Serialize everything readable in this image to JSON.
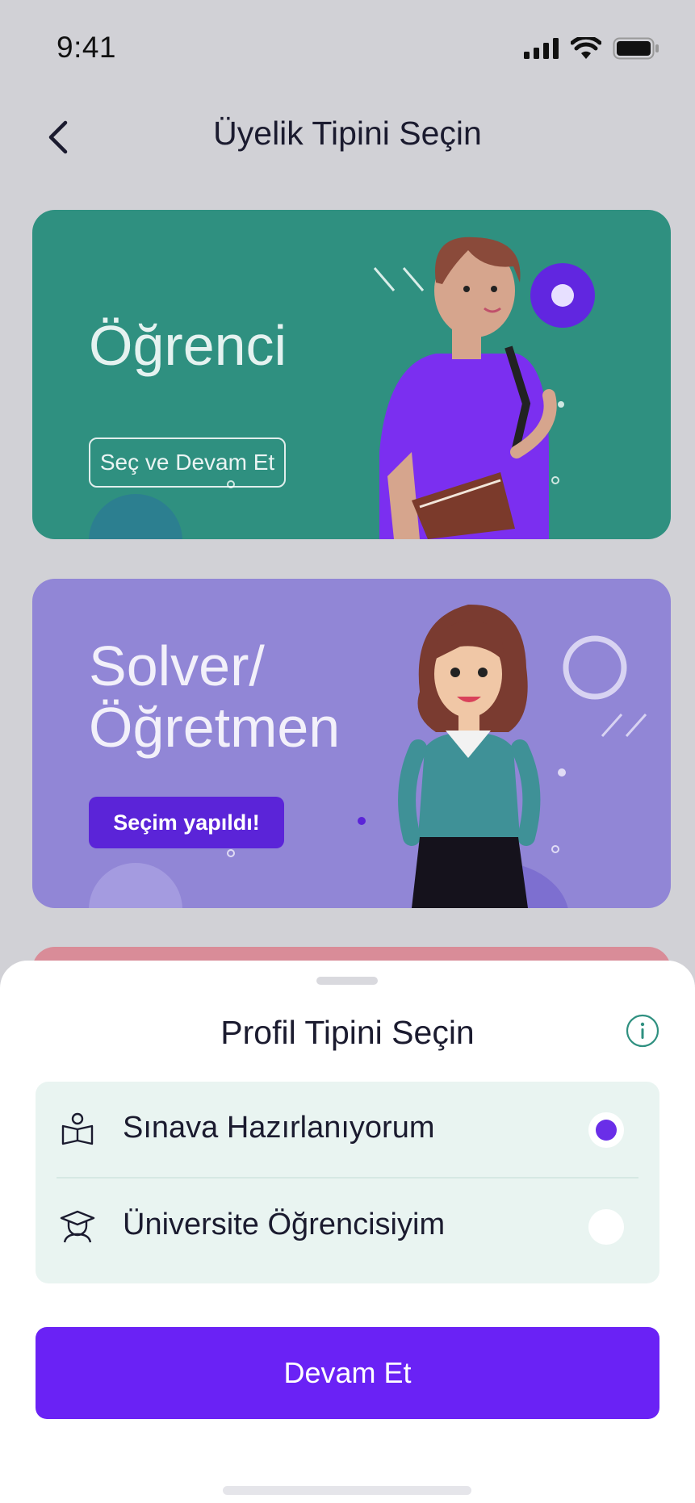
{
  "status_bar": {
    "time": "9:41",
    "icons": [
      "signal-icon",
      "wifi-icon",
      "battery-icon"
    ]
  },
  "header": {
    "title": "Üyelik Tipini Seçin",
    "back_icon": "chevron-left-icon"
  },
  "cards": {
    "student": {
      "title": "Öğrenci",
      "button_label": "Seç ve Devam Et",
      "color": "#2f9080"
    },
    "teacher": {
      "title_line1": "Solver/",
      "title_line2": "Öğretmen",
      "button_label": "Seçim yapıldı!",
      "color": "#9186d6"
    }
  },
  "sheet": {
    "title": "Profil Tipini Seçin",
    "info_icon": "info-icon",
    "options": [
      {
        "label": "Sınava Hazırlanıyorum",
        "icon": "book-reader-icon",
        "selected": true
      },
      {
        "label": "Üniversite Öğrencisiyim",
        "icon": "graduate-icon",
        "selected": false
      }
    ],
    "continue_label": "Devam Et",
    "accent": "#6a22f5"
  }
}
